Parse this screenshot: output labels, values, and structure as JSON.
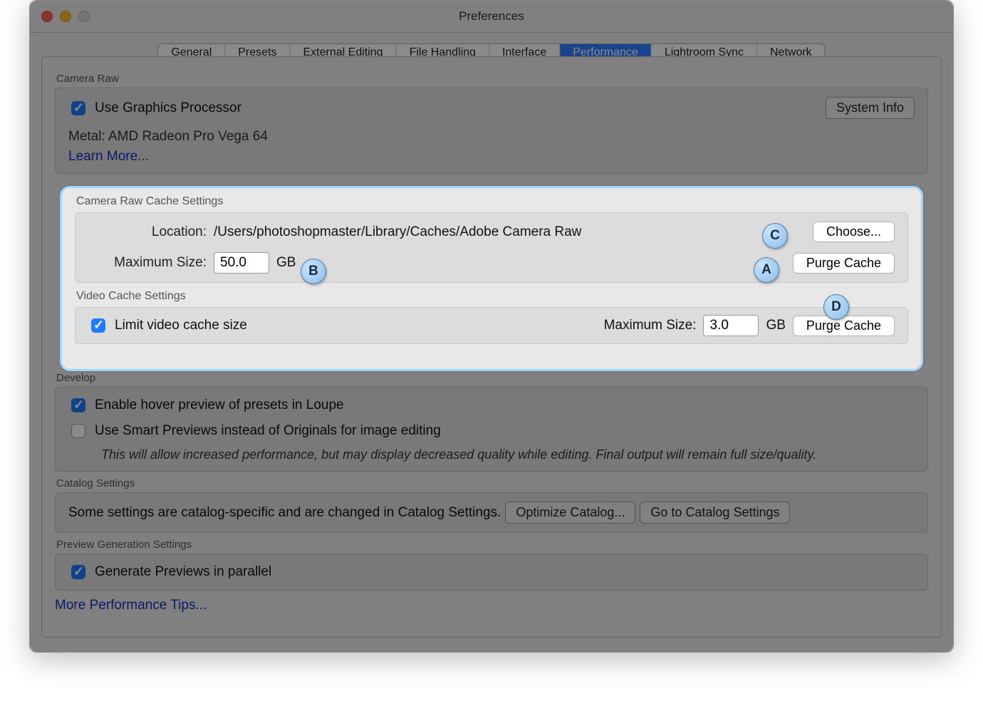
{
  "window": {
    "title": "Preferences"
  },
  "tabs": [
    "General",
    "Presets",
    "External Editing",
    "File Handling",
    "Interface",
    "Performance",
    "Lightroom Sync",
    "Network"
  ],
  "active_tab_index": 5,
  "camera_raw": {
    "title": "Camera Raw",
    "use_gpu_label": "Use Graphics Processor",
    "use_gpu_checked": true,
    "gpu_info": "Metal: AMD Radeon Pro Vega 64",
    "learn_more": "Learn More...",
    "system_info_btn": "System Info"
  },
  "cache": {
    "title": "Camera Raw Cache Settings",
    "location_label": "Location:",
    "location_value": "/Users/photoshopmaster/Library/Caches/Adobe Camera Raw",
    "choose_btn": "Choose...",
    "max_size_label": "Maximum Size:",
    "max_size_value": "50.0",
    "unit": "GB",
    "purge_btn": "Purge Cache"
  },
  "video_cache": {
    "title": "Video Cache Settings",
    "limit_label": "Limit video cache size",
    "limit_checked": true,
    "max_size_label": "Maximum Size:",
    "max_size_value": "3.0",
    "unit": "GB",
    "purge_btn": "Purge Cache"
  },
  "develop": {
    "title": "Develop",
    "hover_label": "Enable hover preview of presets in Loupe",
    "hover_checked": true,
    "smart_label": "Use Smart Previews instead of Originals for image editing",
    "smart_checked": false,
    "note": "This will allow increased performance, but may display decreased quality while editing. Final output will remain full size/quality."
  },
  "catalog": {
    "title": "Catalog Settings",
    "text": "Some settings are catalog-specific and are changed in Catalog Settings.",
    "optimize_btn": "Optimize Catalog...",
    "goto_btn": "Go to Catalog Settings"
  },
  "preview_gen": {
    "title": "Preview Generation Settings",
    "parallel_label": "Generate Previews in parallel",
    "parallel_checked": true
  },
  "more_tips": "More Performance Tips...",
  "markers": {
    "a": "A",
    "b": "B",
    "c": "C",
    "d": "D"
  }
}
